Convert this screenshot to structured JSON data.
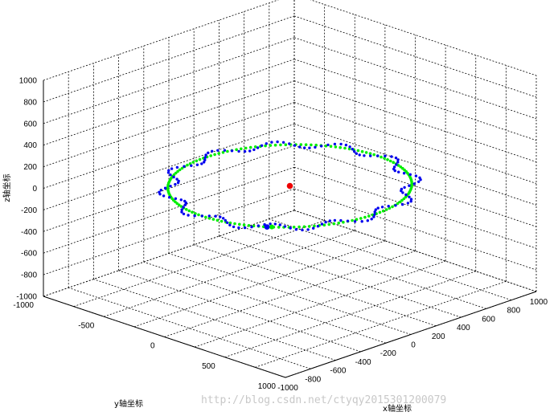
{
  "chart_data": {
    "type": "scatter3d",
    "xlabel": "x轴坐标",
    "ylabel": "y轴坐标",
    "zlabel": "z轴坐标",
    "xlim": [
      -1000,
      1000
    ],
    "ylim": [
      -1000,
      1000
    ],
    "zlim": [
      -1000,
      1000
    ],
    "x_ticks": [
      "1000",
      "800",
      "600",
      "400",
      "200",
      "0",
      "-200",
      "-400",
      "-600",
      "-800",
      "-1000"
    ],
    "y_ticks": [
      "-1000",
      "-500",
      "0",
      "500",
      "1000"
    ],
    "z_ticks": [
      "1000",
      "800",
      "600",
      "400",
      "200",
      "0",
      "-200",
      "-400",
      "-600",
      "-800",
      "-1000"
    ],
    "grid": true,
    "series": [
      {
        "color": "#00ee00",
        "marker": "dot",
        "shape": "circle",
        "radius": 700,
        "z": 0,
        "point_count": 150
      },
      {
        "color": "#0000ee",
        "marker": "dot",
        "shape": "wavy-circle",
        "radius": 700,
        "wave_amplitude": 55,
        "wave_periods": 12,
        "z": 0,
        "point_count": 140
      }
    ],
    "center_point": {
      "x": 0,
      "y": 0,
      "z": 0,
      "color": "#ee0000"
    },
    "start_point": {
      "color": "#0000ee"
    }
  },
  "watermark": "http://blog.csdn.net/ctyqy2015301200079"
}
